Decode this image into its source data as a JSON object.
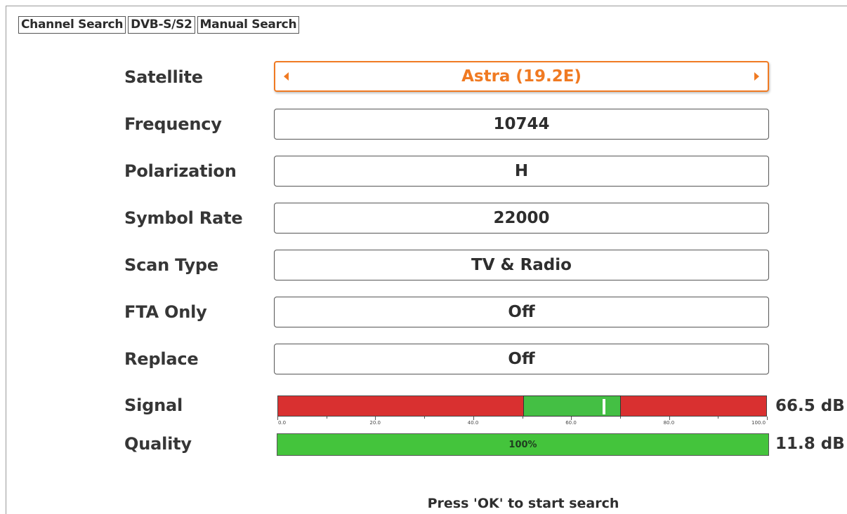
{
  "breadcrumbs": [
    "Channel Search",
    "DVB-S/S2",
    "Manual Search"
  ],
  "form": {
    "satellite": {
      "label": "Satellite",
      "value": "Astra (19.2E)"
    },
    "frequency": {
      "label": "Frequency",
      "value": "10744"
    },
    "polarization": {
      "label": "Polarization",
      "value": "H"
    },
    "symbol_rate": {
      "label": "Symbol Rate",
      "value": "22000"
    },
    "scan_type": {
      "label": "Scan Type",
      "value": "TV & Radio"
    },
    "fta_only": {
      "label": "FTA Only",
      "value": "Off"
    },
    "replace": {
      "label": "Replace",
      "value": "Off"
    }
  },
  "signal": {
    "label": "Signal",
    "readout": "66.5 dB",
    "level": 66.5,
    "good_range": [
      50,
      70
    ],
    "scale_min": 0,
    "scale_max": 100,
    "tick_labels": [
      "0.0",
      "20.0",
      "40.0",
      "60.0",
      "80.0",
      "100.0"
    ]
  },
  "quality": {
    "label": "Quality",
    "percent_text": "100%",
    "level": 100,
    "readout": "11.8 dB"
  },
  "hint": "Press 'OK' to start search",
  "colors": {
    "selected_accent": "#f07a22",
    "meter_bad": "#d93030",
    "meter_good": "#44bf44",
    "quality_bar": "#44c43c"
  },
  "icons": {
    "prev": "triangle-left-icon",
    "next": "triangle-right-icon"
  }
}
